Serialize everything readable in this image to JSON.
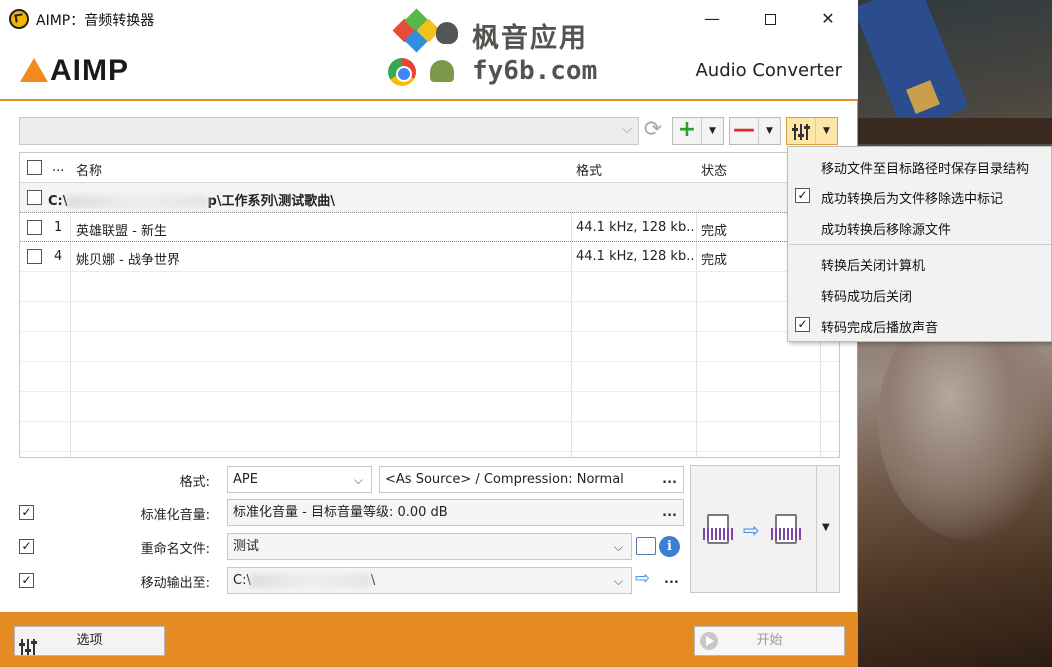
{
  "window": {
    "title": "AIMP：音频转换器",
    "logo": "AIMP",
    "header_title": "Audio Converter"
  },
  "watermark": {
    "line1": "枫音应用",
    "line2": "fy6b.com"
  },
  "table": {
    "columns": [
      "...",
      "名称",
      "格式",
      "状态"
    ],
    "group": {
      "path_prefix": "C:\\",
      "path_suffix": "p\\工作系列\\测试歌曲\\"
    },
    "rows": [
      {
        "num": "1",
        "name": "英雄联盟 - 新生",
        "format": "44.1 kHz, 128 kb...",
        "status": "完成"
      },
      {
        "num": "4",
        "name": "姚贝娜 - 战争世界",
        "format": "44.1 kHz, 128 kb...",
        "status": "完成"
      }
    ]
  },
  "settings": {
    "format_label": "格式:",
    "format_value": "APE",
    "format_params": "<As Source> / Compression: Normal",
    "normalize_label": "标准化音量:",
    "normalize_value": "标准化音量 - 目标音量等级:  0.00 dB",
    "rename_label": "重命名文件:",
    "rename_value": "测试",
    "move_label": "移动输出至:",
    "move_prefix": "C:\\",
    "move_suffix": "\\",
    "ellipsis": "..."
  },
  "footer": {
    "options_label": "选项",
    "start_label": "开始"
  },
  "menu": {
    "items": [
      {
        "label": "移动文件至目标路径时保存目录结构",
        "checked": false
      },
      {
        "label": "成功转换后为文件移除选中标记",
        "checked": true
      },
      {
        "label": "成功转换后移除源文件",
        "checked": false
      },
      {
        "label": "转换后关闭计算机",
        "checked": false
      },
      {
        "label": "转码成功后关闭",
        "checked": false
      },
      {
        "label": "转码完成后播放声音",
        "checked": true
      }
    ]
  },
  "colors": {
    "accent": "#e68a24",
    "add": "#2aa02a",
    "remove": "#d62c2c",
    "info": "#3b7fd4"
  },
  "icons": [
    "app-icon",
    "refresh-icon",
    "plus-icon",
    "minus-icon",
    "equalizer-icon",
    "chevron-down-icon",
    "audio-file-icon",
    "arrow-right-icon",
    "info-icon",
    "play-icon"
  ]
}
